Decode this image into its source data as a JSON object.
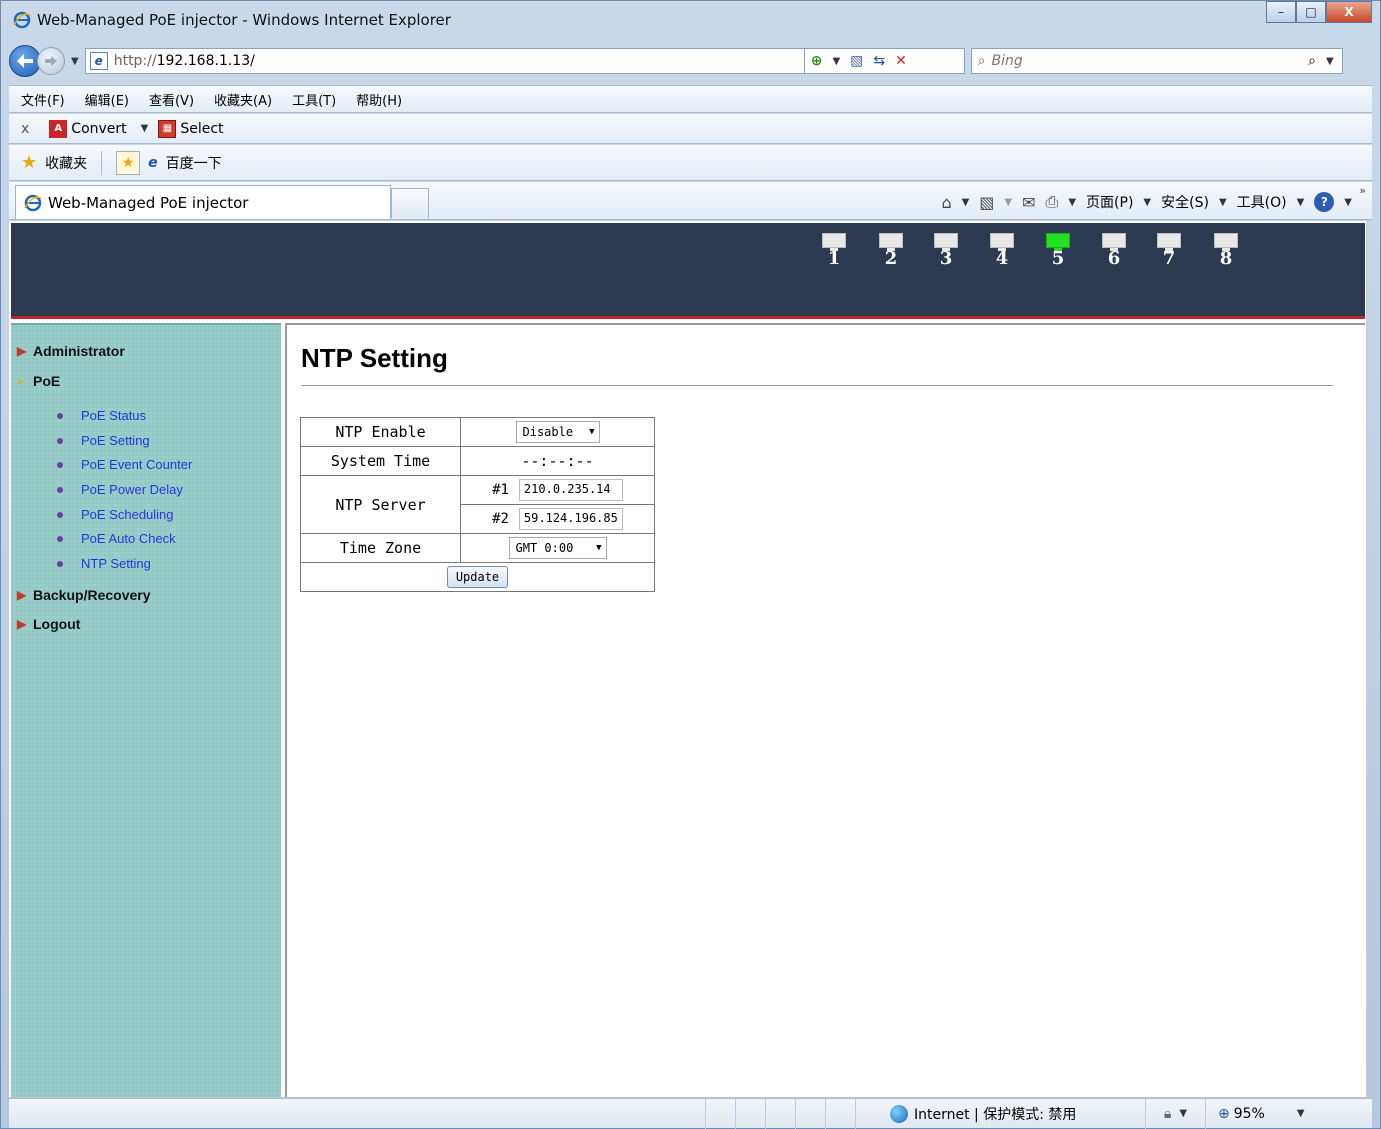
{
  "window": {
    "title": "Web-Managed PoE injector - Windows Internet Explorer",
    "controls": {
      "minimize": "–",
      "maximize": "□",
      "close": "X"
    }
  },
  "address": {
    "url_prefix": "http://",
    "url": "192.168.1.13/",
    "search_placeholder": "Bing"
  },
  "menu": [
    "文件(F)",
    "编辑(E)",
    "查看(V)",
    "收藏夹(A)",
    "工具(T)",
    "帮助(H)"
  ],
  "convert_bar": {
    "close": "x",
    "convert": "Convert",
    "select": "Select"
  },
  "favorites": {
    "label": "收藏夹",
    "baidu": "百度一下"
  },
  "tab": {
    "title": "Web-Managed PoE injector"
  },
  "command_bar": {
    "page": "页面(P)",
    "safety": "安全(S)",
    "tools": "工具(O)"
  },
  "ports": [
    {
      "num": "1",
      "active": false
    },
    {
      "num": "2",
      "active": false
    },
    {
      "num": "3",
      "active": false
    },
    {
      "num": "4",
      "active": false
    },
    {
      "num": "5",
      "active": true
    },
    {
      "num": "6",
      "active": false
    },
    {
      "num": "7",
      "active": false
    },
    {
      "num": "8",
      "active": false
    }
  ],
  "sidebar": {
    "administrator": "Administrator",
    "poe": "PoE",
    "poe_items": [
      "PoE Status",
      "PoE Setting",
      "PoE Event Counter",
      "PoE Power Delay",
      "PoE Scheduling",
      "PoE Auto Check",
      "NTP Setting"
    ],
    "backup": "Backup/Recovery",
    "logout": "Logout"
  },
  "content": {
    "title": "NTP Setting",
    "ntp_enable_label": "NTP Enable",
    "ntp_enable_value": "Disable",
    "system_time_label": "System Time",
    "system_time_value": "--:--:--",
    "ntp_server_label": "NTP Server",
    "server1_index": "#1",
    "server1_value": "210.0.235.14",
    "server2_index": "#2",
    "server2_value": "59.124.196.85",
    "time_zone_label": "Time Zone",
    "time_zone_value": "GMT 0:00",
    "update_label": "Update"
  },
  "status": {
    "zone": "Internet | 保护模式: 禁用",
    "zoom": "95%"
  }
}
